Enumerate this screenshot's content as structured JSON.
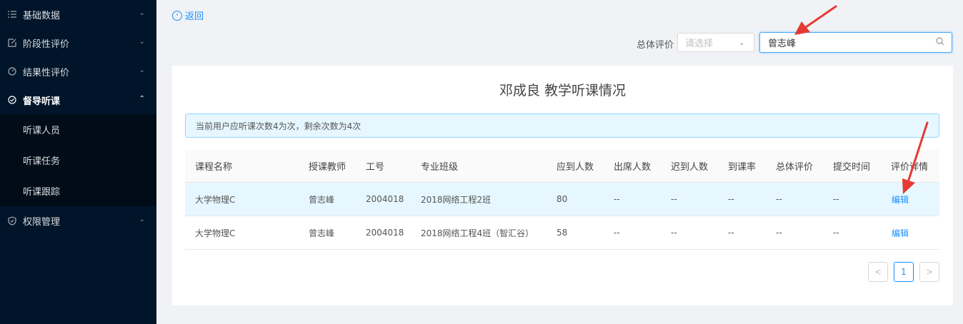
{
  "sidebar": {
    "items": [
      {
        "label": "基础数据",
        "icon": "list-icon"
      },
      {
        "label": "阶段性评价",
        "icon": "edit-square-icon"
      },
      {
        "label": "结果性评价",
        "icon": "dashboard-icon"
      },
      {
        "label": "督导听课",
        "icon": "check-circle-icon"
      },
      {
        "label": "权限管理",
        "icon": "shield-icon"
      }
    ],
    "submenu": [
      "听课人员",
      "听课任务",
      "听课跟踪"
    ]
  },
  "back_label": "返回",
  "filter": {
    "label": "总体评价",
    "select_placeholder": "请选择",
    "search_value": "曾志峰"
  },
  "panel": {
    "title": "邓成良  教学听课情况",
    "alert": "当前用户应听课次数4为次，剩余次数为4次"
  },
  "table": {
    "headers": [
      "课程名称",
      "授课教师",
      "工号",
      "专业班级",
      "应到人数",
      "出席人数",
      "迟到人数",
      "到课率",
      "总体评价",
      "提交时间",
      "评价详情"
    ],
    "rows": [
      [
        "大学物理C",
        "曾志峰",
        "2004018",
        "2018网络工程2班",
        "80",
        "--",
        "--",
        "--",
        "--",
        "--",
        "编辑"
      ],
      [
        "大学物理C",
        "曾志峰",
        "2004018",
        "2018网络工程4班（智汇谷）",
        "58",
        "--",
        "--",
        "--",
        "--",
        "--",
        "编辑"
      ]
    ]
  },
  "pagination": {
    "prev": "<",
    "current": "1",
    "next": ">"
  },
  "colors": {
    "sidebar_bg": "#001529",
    "accent": "#1890ff",
    "annotation_arrow": "#e53935"
  }
}
